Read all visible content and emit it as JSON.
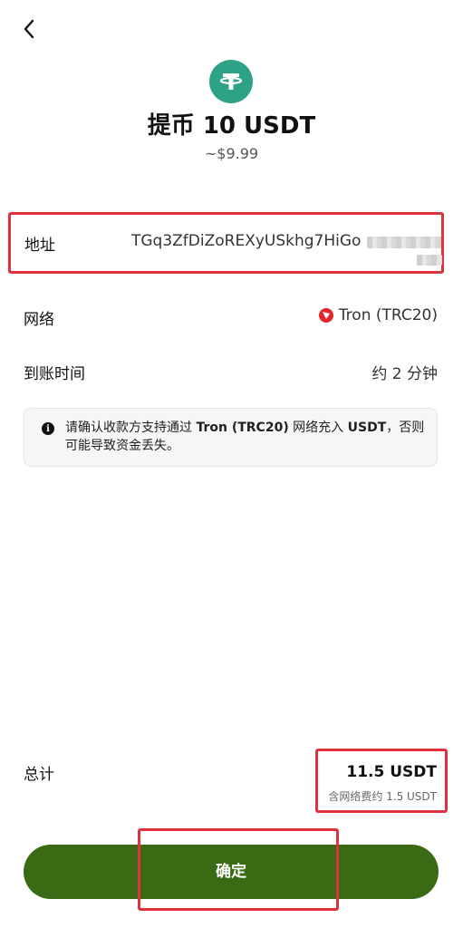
{
  "header": {
    "back_icon": "chevron-left-icon",
    "coin_icon": "tether-usdt-icon",
    "title": "提币 10 USDT",
    "subtitle": "~$9.99"
  },
  "details": {
    "address_label": "地址",
    "address_value": "TGq3ZfDiZoREXyUSkhg7HiGo",
    "address_redacted": true,
    "network_label": "网络",
    "network_icon": "tron-icon",
    "network_value": "Tron (TRC20)",
    "arrival_label": "到账时间",
    "arrival_value": "约 2 分钟"
  },
  "notice": {
    "icon": "info-icon",
    "text_prefix": "请确认收款方支持通过 ",
    "text_network": "Tron (TRC20)",
    "text_middle": " 网络充入 ",
    "text_token": "USDT",
    "text_suffix": "，否则可能导致资金丢失。"
  },
  "summary": {
    "total_label": "总计",
    "total_value": "11.5 USDT",
    "fee_note": "含网络费约 1.5 USDT"
  },
  "actions": {
    "confirm_label": "确定"
  },
  "colors": {
    "brand_green": "#3a6b14",
    "tether_green": "#2ea287",
    "tron_red": "#e3262b",
    "highlight_red": "#e0313e"
  }
}
